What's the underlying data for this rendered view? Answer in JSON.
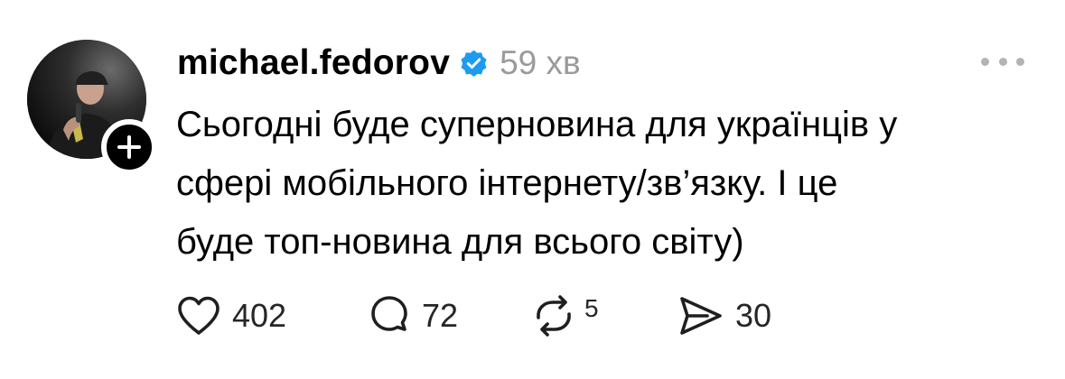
{
  "post": {
    "username": "michael.fedorov",
    "verified": true,
    "timestamp": "59 хв",
    "text_lines": [
      "Сьогодні буде суперновина для українців у",
      "сфері мобільного інтернету/зв’язку. І це",
      "буде топ-новина для всього світу)"
    ]
  },
  "actions": {
    "likes": "402",
    "replies": "72",
    "reposts": "5",
    "shares": "30"
  },
  "icons": {
    "verified": "verified-badge-icon",
    "follow": "plus-icon",
    "more": "more-dots-icon",
    "like": "heart-icon",
    "reply": "comment-bubble-icon",
    "repost": "repost-arrows-icon",
    "share": "send-icon"
  },
  "colors": {
    "verified_blue": "#1d9bf0",
    "muted_text": "#9a9a9a",
    "icon": "#1f1f1f"
  }
}
